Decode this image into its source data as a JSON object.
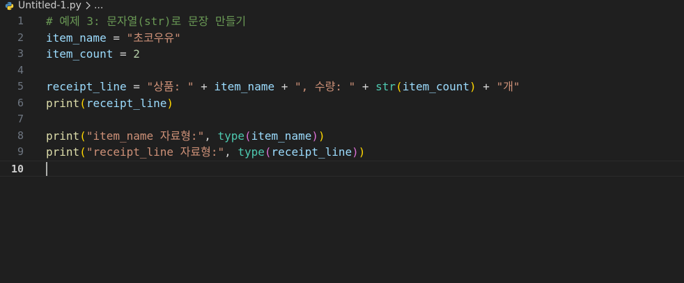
{
  "tab": {
    "filename": "Untitled-1.py",
    "separator": ">",
    "ellipsis": "..."
  },
  "colors": {
    "background": "#1f1f1f",
    "comment": "#6a9955",
    "variable": "#9cdcfe",
    "string": "#ce9178",
    "number": "#b5cea8",
    "function": "#dcdcaa",
    "builtin_type": "#4ec9b0",
    "bracket_level1": "#ffd700",
    "bracket_level2": "#da70d6"
  },
  "editor": {
    "active_line": 10,
    "lines": [
      {
        "number": "1",
        "tokens": [
          {
            "t": "# 예제 3: 문자열(str)로 문장 만들기",
            "k": "c-comment"
          }
        ]
      },
      {
        "number": "2",
        "tokens": [
          {
            "t": "item_name",
            "k": "c-var"
          },
          {
            "t": " = ",
            "k": "c-op"
          },
          {
            "t": "\"초코우유\"",
            "k": "c-str"
          }
        ]
      },
      {
        "number": "3",
        "tokens": [
          {
            "t": "item_count",
            "k": "c-var"
          },
          {
            "t": " = ",
            "k": "c-op"
          },
          {
            "t": "2",
            "k": "c-num"
          }
        ]
      },
      {
        "number": "4",
        "tokens": []
      },
      {
        "number": "5",
        "tokens": [
          {
            "t": "receipt_line",
            "k": "c-var"
          },
          {
            "t": " = ",
            "k": "c-op"
          },
          {
            "t": "\"상품: \"",
            "k": "c-str"
          },
          {
            "t": " + ",
            "k": "c-op"
          },
          {
            "t": "item_name",
            "k": "c-var"
          },
          {
            "t": " + ",
            "k": "c-op"
          },
          {
            "t": "\", 수량: \"",
            "k": "c-str"
          },
          {
            "t": " + ",
            "k": "c-op"
          },
          {
            "t": "str",
            "k": "c-type"
          },
          {
            "t": "(",
            "k": "c-b1"
          },
          {
            "t": "item_count",
            "k": "c-var"
          },
          {
            "t": ")",
            "k": "c-b1"
          },
          {
            "t": " + ",
            "k": "c-op"
          },
          {
            "t": "\"개\"",
            "k": "c-str"
          }
        ]
      },
      {
        "number": "6",
        "tokens": [
          {
            "t": "print",
            "k": "c-fn"
          },
          {
            "t": "(",
            "k": "c-b1"
          },
          {
            "t": "receipt_line",
            "k": "c-var"
          },
          {
            "t": ")",
            "k": "c-b1"
          }
        ]
      },
      {
        "number": "7",
        "tokens": []
      },
      {
        "number": "8",
        "tokens": [
          {
            "t": "print",
            "k": "c-fn"
          },
          {
            "t": "(",
            "k": "c-b1"
          },
          {
            "t": "\"item_name 자료형:\"",
            "k": "c-str"
          },
          {
            "t": ", ",
            "k": "c-op"
          },
          {
            "t": "type",
            "k": "c-type"
          },
          {
            "t": "(",
            "k": "c-b2"
          },
          {
            "t": "item_name",
            "k": "c-var"
          },
          {
            "t": ")",
            "k": "c-b2"
          },
          {
            "t": ")",
            "k": "c-b1"
          }
        ]
      },
      {
        "number": "9",
        "tokens": [
          {
            "t": "print",
            "k": "c-fn"
          },
          {
            "t": "(",
            "k": "c-b1"
          },
          {
            "t": "\"receipt_line 자료형:\"",
            "k": "c-str"
          },
          {
            "t": ", ",
            "k": "c-op"
          },
          {
            "t": "type",
            "k": "c-type"
          },
          {
            "t": "(",
            "k": "c-b2"
          },
          {
            "t": "receipt_line",
            "k": "c-var"
          },
          {
            "t": ")",
            "k": "c-b2"
          },
          {
            "t": ")",
            "k": "c-b1"
          }
        ]
      },
      {
        "number": "10",
        "tokens": []
      }
    ]
  }
}
